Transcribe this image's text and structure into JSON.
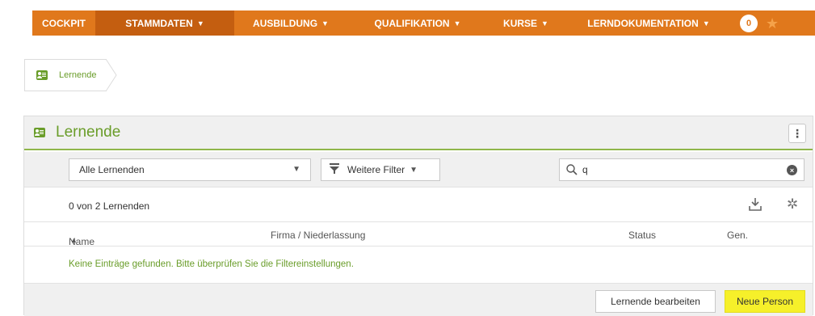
{
  "nav": {
    "items": [
      {
        "label": "COCKPIT",
        "caret": ""
      },
      {
        "label": "STAMMDATEN",
        "caret": "▼"
      },
      {
        "label": "AUSBILDUNG",
        "caret": "▼"
      },
      {
        "label": "QUALIFIKATION",
        "caret": "▼"
      },
      {
        "label": "KURSE",
        "caret": "▼"
      },
      {
        "label": "LERNDOKUMENTATION",
        "caret": "▼"
      }
    ],
    "count": "0",
    "accent": "#e0781c",
    "active_bg": "#c45e10"
  },
  "breadcrumb": {
    "label": "Lernende"
  },
  "panel": {
    "title": "Lernende",
    "menu_icon": "⋮",
    "filter": {
      "select_value": "Alle Lernenden",
      "more_filters": "Weitere Filter",
      "search_value": "q"
    },
    "count_text": "0 von 2 Lernenden",
    "columns": [
      "Name",
      "Firma / Niederlassung",
      "Status",
      "Gen."
    ],
    "sort_indicator": "▲",
    "empty_message": "Keine Einträge gefunden. Bitte überprüfen Sie die Filtereinstellungen.",
    "buttons": {
      "edit": "Lernende bearbeiten",
      "new": "Neue Person"
    }
  },
  "colors": {
    "green": "#6a9d2a",
    "highlight": "#f6f02a"
  }
}
